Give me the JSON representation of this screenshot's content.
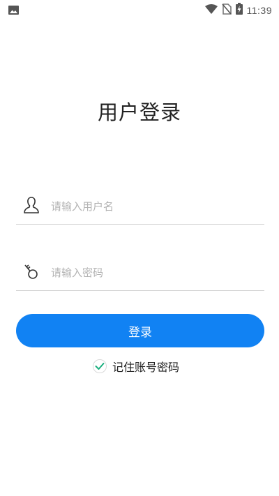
{
  "status_bar": {
    "time": "11:39",
    "icons": [
      "image-icon",
      "wifi-icon",
      "no-sim-icon",
      "battery-charging-icon"
    ]
  },
  "title": "用户登录",
  "username": {
    "placeholder": "请输入用户名",
    "value": "",
    "icon": "user-icon"
  },
  "password": {
    "placeholder": "请输入密码",
    "value": "",
    "icon": "key-icon"
  },
  "login_button": {
    "label": "登录"
  },
  "remember": {
    "label": "记住账号密码",
    "checked": true
  },
  "colors": {
    "primary": "#1182f3",
    "check": "#1aaf7e",
    "divider": "#d5d5d5"
  }
}
